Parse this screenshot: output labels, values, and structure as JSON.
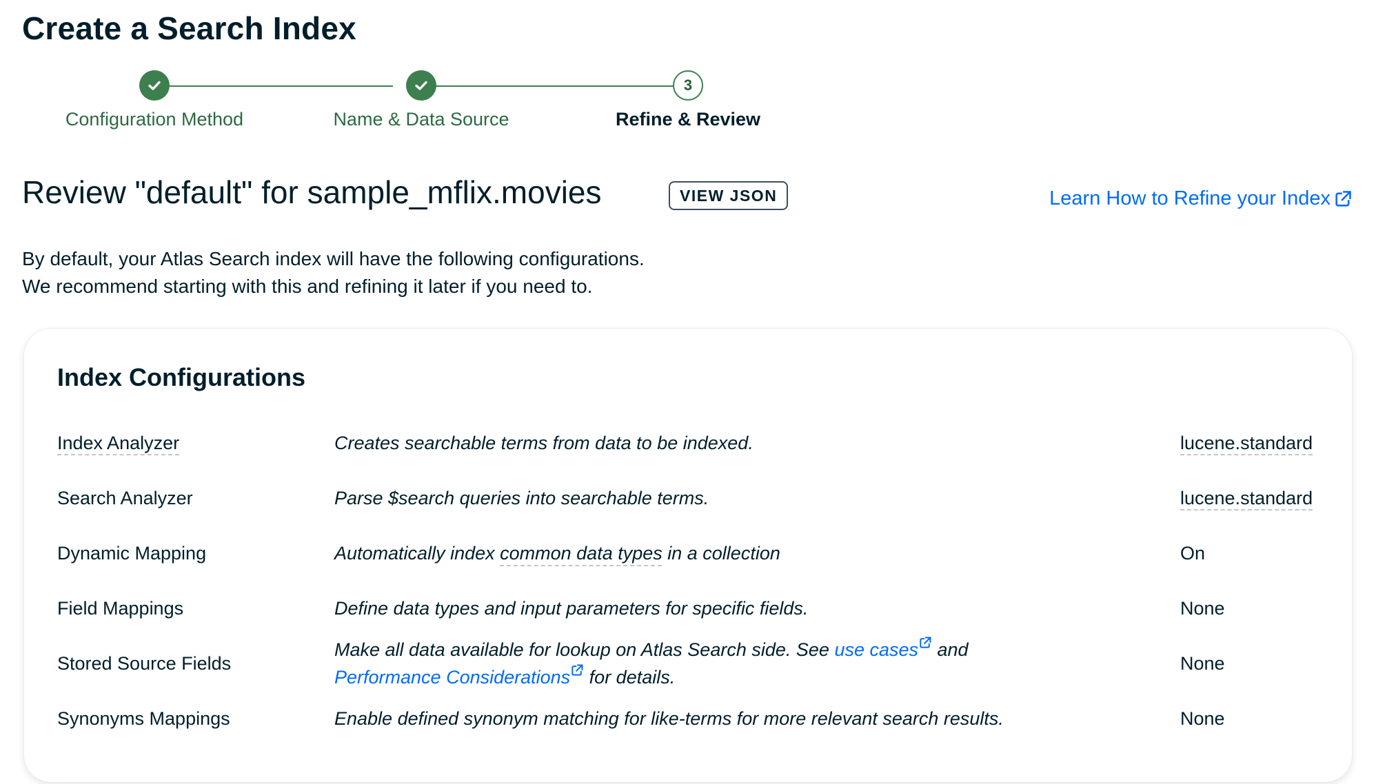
{
  "page": {
    "title": "Create a Search Index"
  },
  "stepper": {
    "steps": [
      {
        "label": "Configuration Method",
        "status": "complete",
        "icon": "check-icon"
      },
      {
        "label": "Name & Data Source",
        "status": "complete",
        "icon": "check-icon"
      },
      {
        "label": "Refine & Review",
        "status": "current",
        "number": "3"
      }
    ]
  },
  "review": {
    "title": "Review \"default\" for sample_mflix.movies",
    "view_json_label": "VIEW JSON",
    "learn_link_label": "Learn How to Refine your Index",
    "learn_link_icon": "external-link-icon",
    "intro_line1": "By default, your Atlas Search index will have the following configurations.",
    "intro_line2": "We recommend starting with this and refining it later if you need to."
  },
  "card": {
    "title": "Index Configurations",
    "rows": [
      {
        "name": "Index Analyzer",
        "description": "Creates searchable terms from data to be indexed.",
        "value": "lucene.standard"
      },
      {
        "name": "Search Analyzer",
        "description": "Parse $search queries into searchable terms.",
        "value": "lucene.standard"
      },
      {
        "name": "Dynamic Mapping",
        "description_before": "Automatically index ",
        "description_term": "common data types",
        "description_after": " in a collection",
        "value": "On"
      },
      {
        "name": "Field Mappings",
        "description": "Define data types and input parameters for specific fields.",
        "value": "None"
      },
      {
        "name": "Stored Source Fields",
        "description_part1": "Make all data available for lookup on Atlas Search side. See ",
        "link1_label": "use cases",
        "description_part2": " and",
        "link2_label": "Performance Considerations",
        "description_part3": " for details.",
        "value": "None"
      },
      {
        "name": "Synonyms Mappings",
        "description": "Enable defined synonym matching for like-terms for more relevant search results.",
        "value": "None"
      }
    ]
  },
  "colors": {
    "brand_green": "#3d7f4f",
    "link_blue": "#016bf8",
    "text_dark": "#001e2b"
  }
}
